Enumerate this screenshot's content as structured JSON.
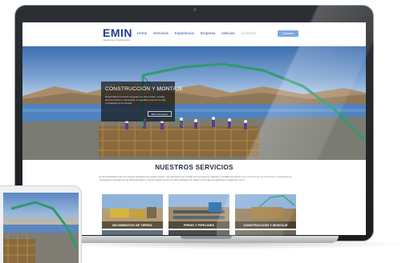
{
  "site": {
    "logo": "EMIN",
    "logo_sub": "Ingeniería y Construcción",
    "menu": [
      {
        "label": "Home",
        "faded": false
      },
      {
        "label": "Servicios",
        "faded": false
      },
      {
        "label": "Experiencia",
        "faded": false
      },
      {
        "label": "Empresa",
        "faded": false
      },
      {
        "label": "Noticias",
        "faded": false
      },
      {
        "label": "Contacto",
        "faded": true
      }
    ],
    "nav_button": "Contacto"
  },
  "hero": {
    "title": "CONSTRUCCIÓN Y MONTAJE",
    "description": "Desarrollamos servicios integrales de obras civiles, montaje electromecánico y estructuras, en aquellas proyectos de alta complejidad de la industria.",
    "button": "Más Información"
  },
  "services": {
    "title": "NUESTROS SERVICIOS",
    "intro": "En la incorporación entre los procesos estratégicos de nuestro negocio, nos esforzamos por entregar servicios seguros, eficientes y rentables de acuerdo a los requerimientos de cada cliente. La tecnología de vanguardia, el equipamiento de última generación y nuestro capital humano con altos estándares de calidad, son la base que garantiza un trabajo bien hecho.",
    "cards": [
      {
        "label": "MOVIMIENTOS DE TIERRA"
      },
      {
        "label": "PIPING Y PIPELINES"
      },
      {
        "label": "CONSTRUCCIÓN Y MONTAJE"
      }
    ]
  },
  "colors": {
    "brand": "#1f3f8f",
    "menu_link": "#2a4f9c",
    "nav_button": "#7fa8e0",
    "title_text": "#1e2a3a"
  }
}
